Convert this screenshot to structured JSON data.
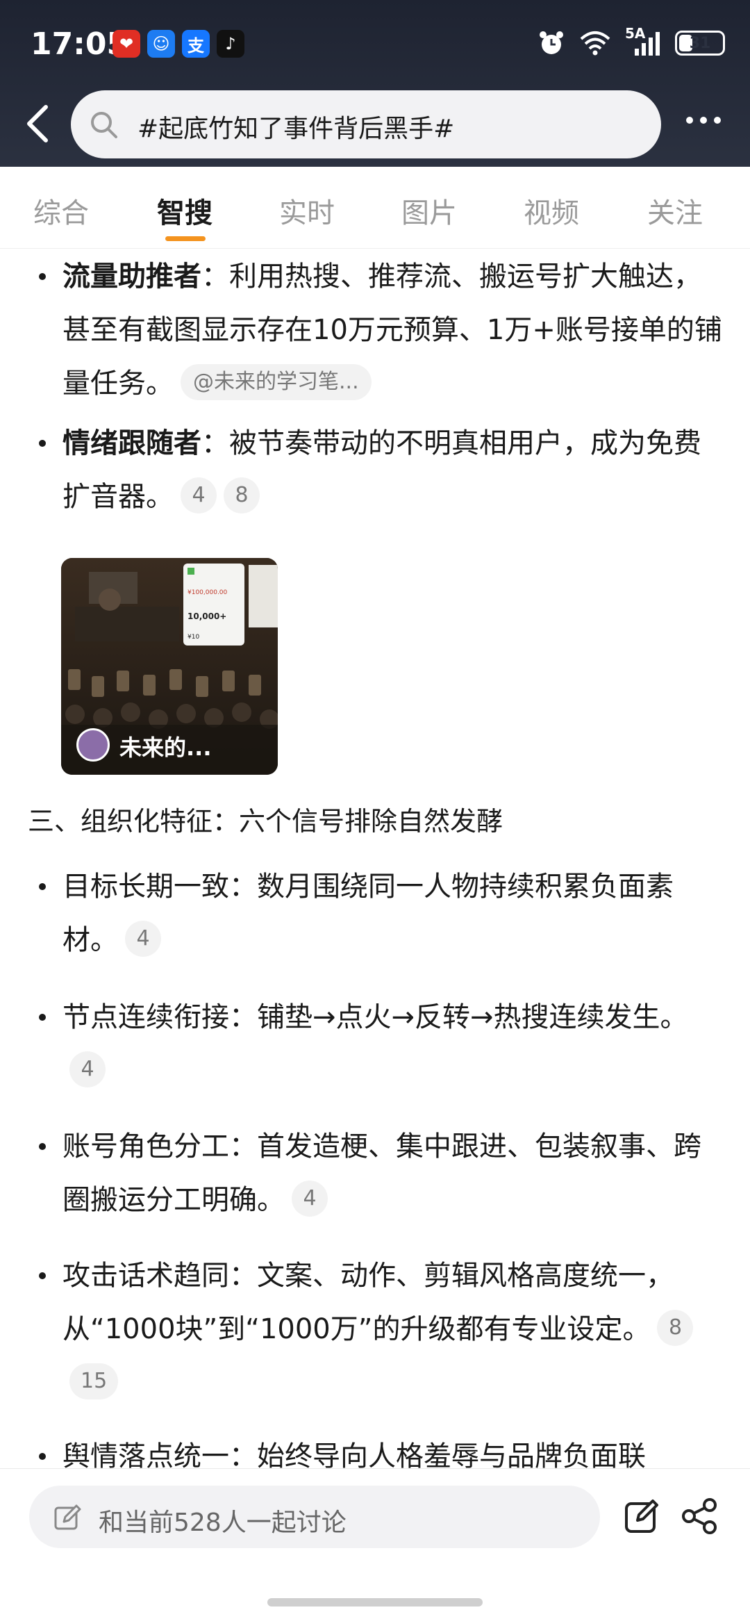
{
  "status_bar": {
    "time": "17:05",
    "app_icons": [
      {
        "name": "pinduoduo-icon",
        "glyph": "❤"
      },
      {
        "name": "robot-app-icon",
        "glyph": "☺"
      },
      {
        "name": "alipay-icon",
        "glyph": "支"
      },
      {
        "name": "douyin-icon",
        "glyph": "♪"
      }
    ],
    "network": "5A",
    "battery": "31",
    "battery_level": 0.31
  },
  "search": {
    "query": "#起底竹知了事件背后黑手#"
  },
  "tabs": [
    {
      "label": "综合",
      "active": false
    },
    {
      "label": "智搜",
      "active": true
    },
    {
      "label": "实时",
      "active": false
    },
    {
      "label": "图片",
      "active": false
    },
    {
      "label": "视频",
      "active": false
    },
    {
      "label": "关注",
      "active": false
    }
  ],
  "content": {
    "bullets_top": [
      {
        "bold": "流量助推者",
        "text": "：利用热搜、推荐流、搬运号扩大触达，甚至有截图显示存在10万元预算、1万+账号接单的铺量任务。",
        "cites": [
          "@未来的学习笔..."
        ]
      },
      {
        "bold": "情绪跟随者",
        "text": "：被节奏带动的不明真相用户，成为免费扩音器。",
        "cites": [
          "4",
          "8"
        ]
      }
    ],
    "thumbnail": {
      "caption": "未来的...",
      "overlay_texts": [
        "¥100,000.00",
        "10,000+",
        "¥10"
      ]
    },
    "section_heading": "三、组织化特征：六个信号排除自然发酵",
    "bullets_section": [
      {
        "text": "目标长期一致：数月围绕同一人物持续积累负面素材。",
        "cites": [
          "4"
        ]
      },
      {
        "text": "节点连续衔接：铺垫→点火→反转→热搜连续发生。",
        "cites": [
          "4"
        ]
      },
      {
        "text": "账号角色分工：首发造梗、集中跟进、包装叙事、跨圈搬运分工明确。",
        "cites": [
          "4"
        ]
      },
      {
        "text": "攻击话术趋同：文案、动作、剪辑风格高度统一，从“1000块”到“1000万”的升级都有专业设定。",
        "cites": [
          "8",
          "15"
        ]
      },
      {
        "text": "舆情落点统一：始终导向人格羞辱与品牌负面联",
        "cites": []
      }
    ]
  },
  "bottom_bar": {
    "discuss_placeholder": "和当前528人一起讨论"
  }
}
